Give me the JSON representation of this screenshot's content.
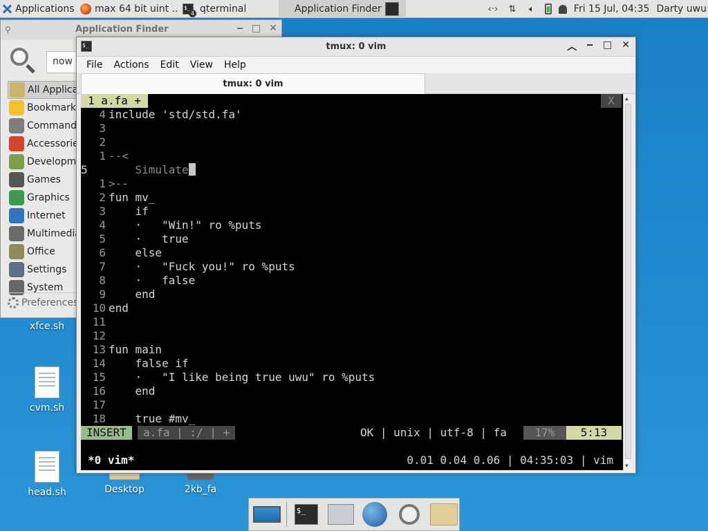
{
  "panel": {
    "applications_label": "Applications",
    "tasks": [
      {
        "label": "max 64 bit uint ..."
      },
      {
        "label": "qterminal",
        "badge": "4"
      },
      {
        "label": "Application Finder"
      }
    ],
    "clock": "Fri 15 Jul, 04:35",
    "user": "Darty uwu"
  },
  "desktop_icons": [
    {
      "label": "xfce.sh"
    },
    {
      "label": "cvm.sh"
    },
    {
      "label": "head.sh"
    },
    {
      "label": "Desktop"
    },
    {
      "label": "2kb_fa"
    }
  ],
  "appfinder": {
    "title": "Application Finder",
    "search_value": "now r",
    "categories": [
      {
        "label": "All Applications",
        "color": "#c9b46a"
      },
      {
        "label": "Bookmarks",
        "color": "#f2c12e"
      },
      {
        "label": "Commands",
        "color": "#7d7d7d"
      },
      {
        "label": "Accessories",
        "color": "#d8412a"
      },
      {
        "label": "Development",
        "color": "#7aa04a"
      },
      {
        "label": "Games",
        "color": "#555555"
      },
      {
        "label": "Graphics",
        "color": "#3b9a4b"
      },
      {
        "label": "Internet",
        "color": "#2f74c0"
      },
      {
        "label": "Multimedia",
        "color": "#6b6b6b"
      },
      {
        "label": "Office",
        "color": "#8c8c5a"
      },
      {
        "label": "Settings",
        "color": "#5c6f8a"
      },
      {
        "label": "System",
        "color": "#666666"
      }
    ],
    "preferences_label": "Preferences"
  },
  "qterminal": {
    "title": "tmux: 0 vim",
    "menus": [
      "File",
      "Actions",
      "Edit",
      "View",
      "Help"
    ],
    "tab_label": "tmux: 0 vim"
  },
  "vim": {
    "tabline": "1 a.fa +",
    "tab_close": "X",
    "lines": [
      {
        "num": "4",
        "text": "include 'std/std.fa'"
      },
      {
        "num": "3",
        "text": ""
      },
      {
        "num": "2",
        "text": ""
      },
      {
        "num": "1",
        "text": "--<",
        "dim": true
      },
      {
        "num": "5",
        "text": "    Simulate",
        "dim": true,
        "current": true,
        "cursor": true
      },
      {
        "num": "1",
        "text": ">--",
        "dim": true
      },
      {
        "num": "2",
        "text": "fun mv_"
      },
      {
        "num": "3",
        "text": "    if"
      },
      {
        "num": "4",
        "text": "    ·   \"Win!\" ro %puts"
      },
      {
        "num": "5",
        "text": "    ·   true"
      },
      {
        "num": "6",
        "text": "    else"
      },
      {
        "num": "7",
        "text": "    ·   \"Fuck you!\" ro %puts"
      },
      {
        "num": "8",
        "text": "    ·   false"
      },
      {
        "num": "9",
        "text": "    end"
      },
      {
        "num": "10",
        "text": "end"
      },
      {
        "num": "11",
        "text": ""
      },
      {
        "num": "12",
        "text": ""
      },
      {
        "num": "13",
        "text": "fun main"
      },
      {
        "num": "14",
        "text": "    false if"
      },
      {
        "num": "15",
        "text": "    ·   \"I like being true uwu\" ro %puts"
      },
      {
        "num": "16",
        "text": "    end"
      },
      {
        "num": "17",
        "text": ""
      },
      {
        "num": "18",
        "text": "    true #mv_"
      }
    ],
    "status": {
      "mode": "INSERT",
      "file": "a.fa | :/ | +",
      "info": "OK | unix | utf-8 | fa",
      "percent": "17%",
      "position": "5:13"
    }
  },
  "tmux": {
    "window": "*0 vim*",
    "right": "0.01 0.04 0.06 | 04:35:03 | vim"
  },
  "dock": {
    "terminal_glyph": "$_"
  }
}
